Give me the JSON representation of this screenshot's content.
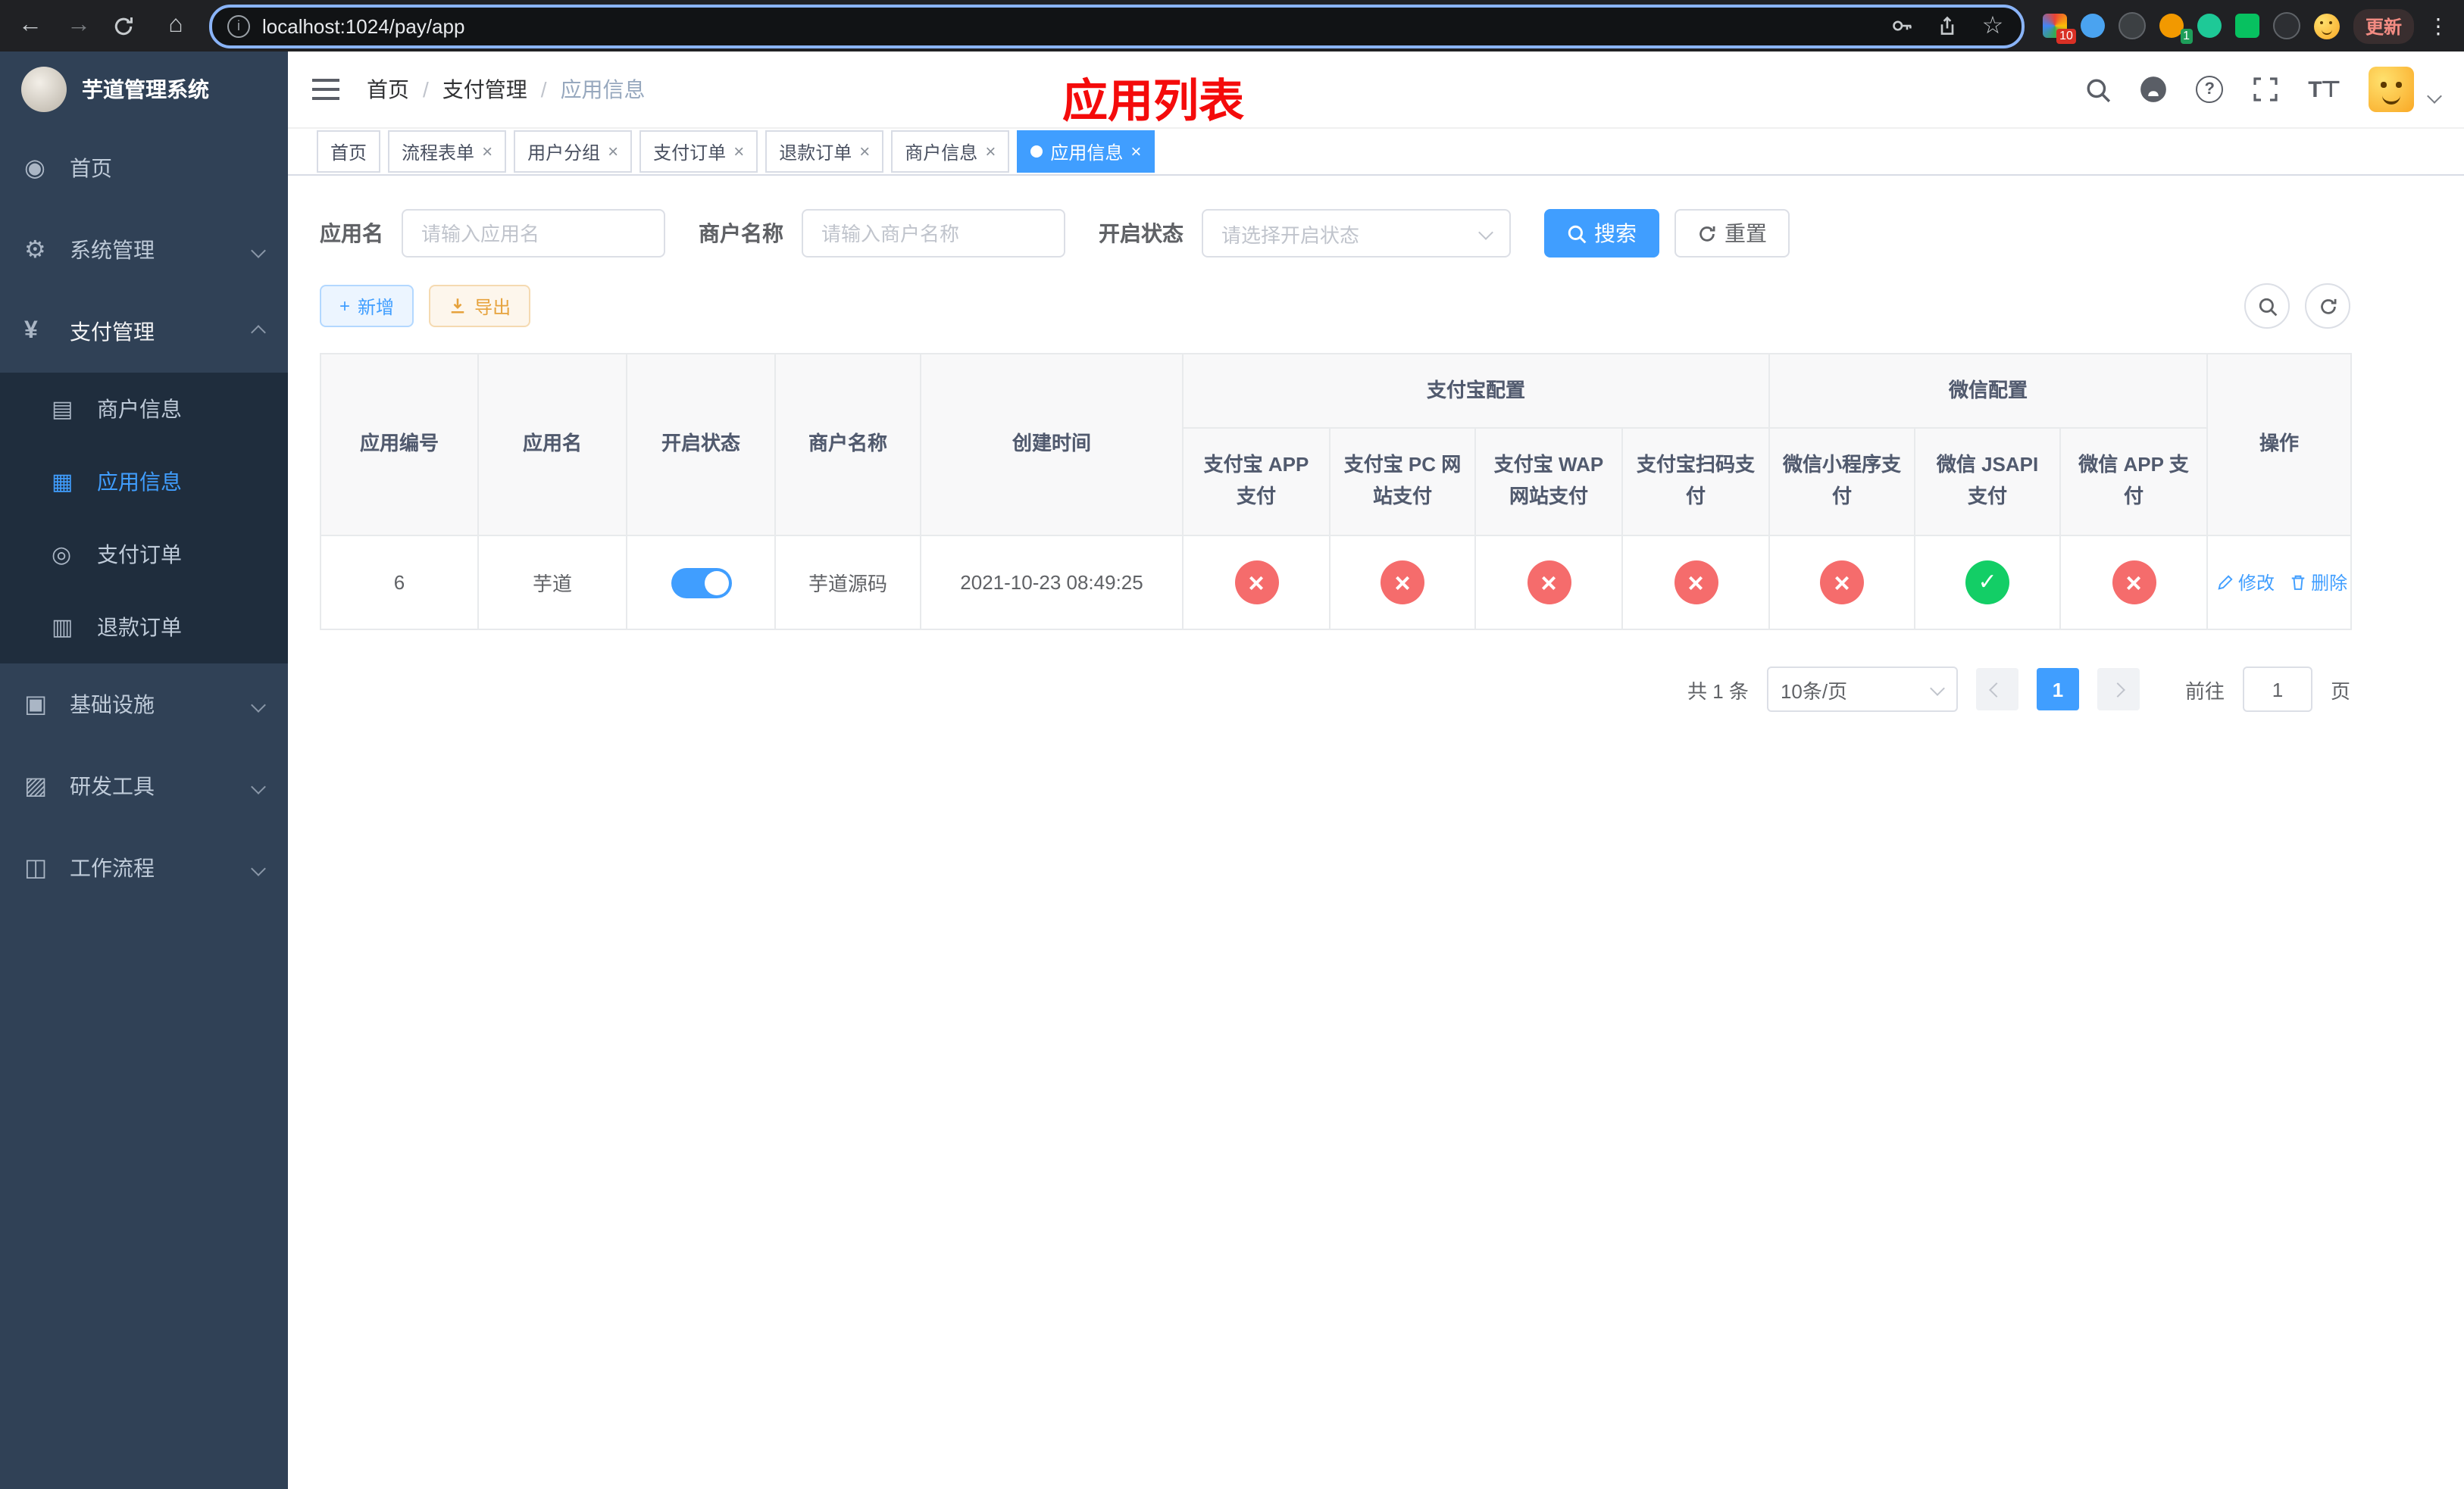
{
  "colors": {
    "accent": "#409eff",
    "success": "#13ce66",
    "danger": "#f56c6c",
    "warning": "#e6a23c",
    "sidebar_bg": "#304156",
    "annotation_red": "#f40b0b"
  },
  "browser": {
    "url": "localhost:1024/pay/app",
    "update_label": "更新",
    "ext_badge_count": "10",
    "profile_badge_count": "1"
  },
  "sidebar": {
    "title": "芋道管理系统",
    "home": "首页",
    "system": "系统管理",
    "payment": "支付管理",
    "merchant_info": "商户信息",
    "app_info": "应用信息",
    "pay_order": "支付订单",
    "refund_order": "退款订单",
    "infra": "基础设施",
    "dev_tools": "研发工具",
    "workflow": "工作流程"
  },
  "topbar": {
    "breadcrumb": [
      "首页",
      "支付管理",
      "应用信息"
    ],
    "separator": "/",
    "overlay_title": "应用列表"
  },
  "tabs": [
    {
      "label": "首页"
    },
    {
      "label": "流程表单"
    },
    {
      "label": "用户分组"
    },
    {
      "label": "支付订单"
    },
    {
      "label": "退款订单"
    },
    {
      "label": "商户信息"
    },
    {
      "label": "应用信息"
    }
  ],
  "filters": {
    "app_name_label": "应用名",
    "app_name_placeholder": "请输入应用名",
    "merchant_label": "商户名称",
    "merchant_placeholder": "请输入商户名称",
    "status_label": "开启状态",
    "status_placeholder": "请选择开启状态",
    "search_button": "搜索",
    "reset_button": "重置"
  },
  "toolbar": {
    "add_button": "新增",
    "export_button": "导出"
  },
  "table": {
    "columns": {
      "app_id": "应用编号",
      "app_name": "应用名",
      "status": "开启状态",
      "merchant": "商户名称",
      "created": "创建时间",
      "op": "操作"
    },
    "groups": {
      "alipay": "支付宝配置",
      "wechat": "微信配置"
    },
    "sub_columns": [
      "支付宝 APP 支付",
      "支付宝 PC 网站支付",
      "支付宝 WAP 网站支付",
      "支付宝扫码支付",
      "微信小程序支付",
      "微信 JSAPI 支付",
      "微信 APP 支付"
    ],
    "rows": [
      {
        "app_id": "6",
        "app_name": "芋道",
        "enabled": "on",
        "merchant": "芋道源码",
        "created": "2021-10-23 08:49:25",
        "statuses": [
          "cross",
          "cross",
          "cross",
          "cross",
          "cross",
          "check",
          "cross"
        ],
        "edit_label": "修改",
        "delete_label": "删除"
      }
    ]
  },
  "pagination": {
    "total_text": "共 1 条",
    "page_size": "10条/页",
    "current_page": "1",
    "goto_label": "前往",
    "goto_value": "1",
    "page_unit": "页"
  }
}
